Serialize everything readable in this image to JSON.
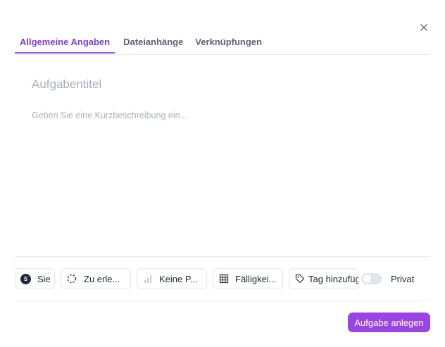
{
  "dialog": {
    "close_icon": "close-icon",
    "tabs": [
      {
        "label": "Allgemeine Angaben",
        "active": true
      },
      {
        "label": "Dateianhänge",
        "active": false
      },
      {
        "label": "Verknüpfungen",
        "active": false
      }
    ],
    "title_placeholder": "Aufgabentitel",
    "description_placeholder": "Geben Sie eine Kurzbeschreibung ein...",
    "toolbar": {
      "assignee": {
        "avatar_initial": "S",
        "label": "Sie"
      },
      "status": {
        "icon": "dashed-circle-icon",
        "label": "Zu erle..."
      },
      "priority": {
        "icon": "bar-chart-icon",
        "label": "Keine P..."
      },
      "due_date": {
        "icon": "calendar-grid-icon",
        "label": "Fälligkei..."
      },
      "tag": {
        "icon": "tag-icon",
        "label": "Tag hinzufügen"
      },
      "private": {
        "label": "Privat",
        "enabled": false
      }
    },
    "submit_label": "Aufgabe anlegen",
    "colors": {
      "accent": "#9945e6",
      "active_tab": "#7c3fd8",
      "avatar_bg": "#1e2a3a"
    }
  }
}
